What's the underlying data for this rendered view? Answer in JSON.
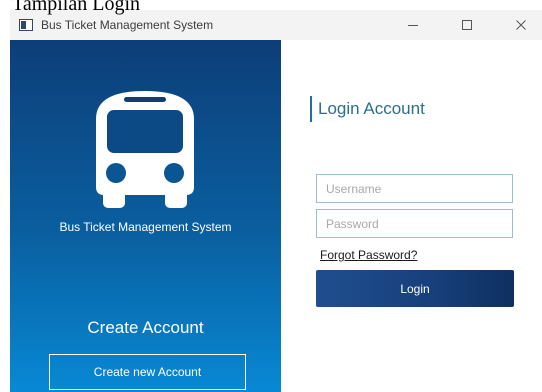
{
  "caption": "Tampilan Login",
  "window": {
    "title": "Bus Ticket Management System",
    "controls": [
      "minimize-icon",
      "maximize-icon",
      "close-icon"
    ]
  },
  "left_panel": {
    "icon": "bus-icon",
    "app_name": "Bus Ticket Management System",
    "create_heading": "Create Account",
    "create_button": "Create new Account"
  },
  "login": {
    "heading": "Login Account",
    "username_placeholder": "Username",
    "password_placeholder": "Password",
    "forgot_link": "Forgot Password?",
    "login_button": "Login"
  },
  "colors": {
    "panel_top": "#0d3e78",
    "panel_bottom": "#0889d4",
    "login_button": "#173f7a",
    "heading": "#2a6f8f"
  }
}
